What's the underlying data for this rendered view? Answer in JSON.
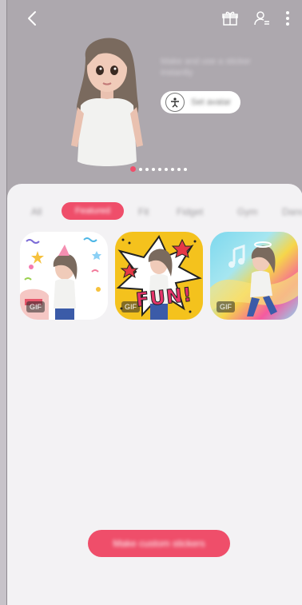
{
  "header": {
    "back_icon": "chevron-left-icon",
    "gift_icon": "gift-icon",
    "profile_icon": "profile-list-icon",
    "more_icon": "more-vertical-icon"
  },
  "hero": {
    "bubble_text": "Make and use a sticker instantly",
    "pill_label": "Set avatar",
    "pill_icon": "person-pose-icon",
    "page_dots_total": 9,
    "page_dots_active": 1
  },
  "tabs": {
    "items": [
      "All",
      "Featured",
      "Fit",
      "Fidget",
      "Gym",
      "Dance"
    ],
    "active": "Featured"
  },
  "stickers": [
    {
      "name": "birthday-sticker",
      "badge": "GIF"
    },
    {
      "name": "fun-sticker",
      "badge": "GIF",
      "caption": "FUN!"
    },
    {
      "name": "dance-sticker",
      "badge": "GIF"
    }
  ],
  "action": {
    "label": "Make custom stickers"
  },
  "colors": {
    "accent": "#ef4e6a",
    "hero_bg": "#ada8ae",
    "sheet_bg": "#f3f2f4"
  }
}
